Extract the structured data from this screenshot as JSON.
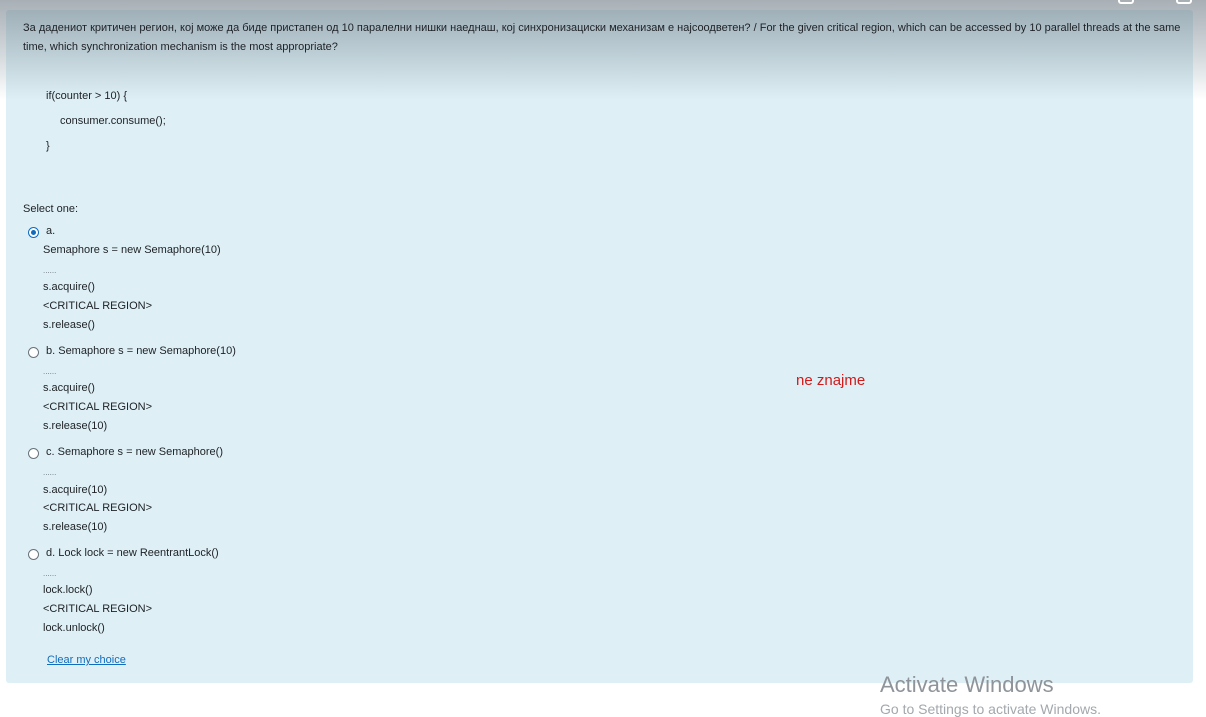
{
  "question": {
    "text": "За дадениот критичен регион, кој може да биде пристапен од 10 паралелни нишки наеднаш, кој синхронизациски механизам е најсоодветен? / For the given critical region, which can be accessed by 10 parallel threads at the same time, which synchronization mechanism is the most appropriate?",
    "code": {
      "line1": "if(counter > 10) {",
      "line2": "consumer.consume();",
      "line3": "}"
    }
  },
  "select_label": "Select one:",
  "options": [
    {
      "selected": true,
      "first_line": "a.",
      "lines": [
        "Semaphore s = new Semaphore(10)",
        "......",
        "s.acquire()",
        "<CRITICAL REGION>",
        "s.release()"
      ]
    },
    {
      "selected": false,
      "first_line": "b. Semaphore s = new Semaphore(10)",
      "lines": [
        "......",
        "s.acquire()",
        "<CRITICAL REGION>",
        "s.release(10)"
      ]
    },
    {
      "selected": false,
      "first_line": "c. Semaphore s = new Semaphore()",
      "lines": [
        "......",
        "s.acquire(10)",
        "<CRITICAL REGION>",
        "s.release(10)"
      ]
    },
    {
      "selected": false,
      "first_line": "d. Lock lock = new ReentrantLock()",
      "lines": [
        "......",
        "lock.lock()",
        "<CRITICAL REGION>",
        "lock.unlock()"
      ]
    }
  ],
  "clear_choice": "Clear my choice",
  "annotation": "ne znajme",
  "watermark": {
    "title": "Activate Windows",
    "subtitle": "Go to Settings to activate Windows."
  },
  "colors": {
    "panel_bg": "#def0f6",
    "link": "#0f6cbf",
    "annotation": "#d21a1a"
  }
}
